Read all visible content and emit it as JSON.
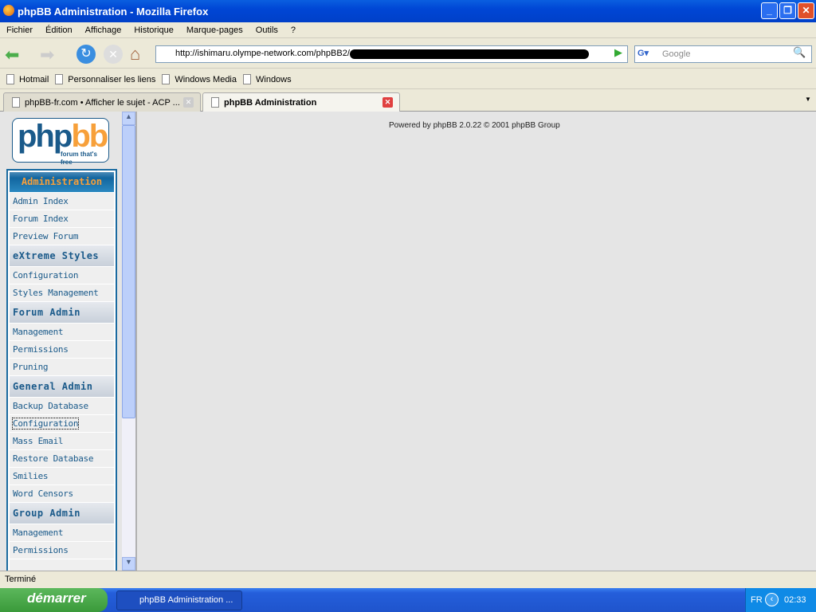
{
  "window": {
    "title": "phpBB Administration - Mozilla Firefox"
  },
  "menu": [
    "Fichier",
    "Édition",
    "Affichage",
    "Historique",
    "Marque-pages",
    "Outils",
    "?"
  ],
  "toolbar": {
    "url": "http://ishimaru.olympe-network.com/phpBB2/",
    "search_placeholder": "Google"
  },
  "bookmarks": [
    "Hotmail",
    "Personnaliser les liens",
    "Windows Media",
    "Windows"
  ],
  "tabs": [
    {
      "label": "phpBB-fr.com • Afficher le sujet - ACP ..."
    },
    {
      "label": "phpBB Administration"
    }
  ],
  "logo": {
    "text1": "php",
    "text2": "bb",
    "tagline": "forum that's free"
  },
  "nav": {
    "admin_header": "Administration",
    "admin": [
      "Admin Index",
      "Forum Index",
      "Preview Forum"
    ],
    "sections": [
      {
        "title": "eXtreme Styles",
        "items": [
          "Configuration",
          "Styles Management"
        ]
      },
      {
        "title": "Forum Admin",
        "items": [
          "Management",
          "Permissions",
          "Pruning"
        ]
      },
      {
        "title": "General Admin",
        "items": [
          "Backup Database",
          "Configuration",
          "Mass Email",
          "Restore Database",
          "Smilies",
          "Word Censors"
        ]
      },
      {
        "title": "Group Admin",
        "items": [
          "Management",
          "Permissions"
        ]
      }
    ]
  },
  "main": {
    "powered": "Powered by phpBB 2.0.22 © 2001 phpBB Group"
  },
  "status": "Terminé",
  "taskbar": {
    "start": "démarrer",
    "task": "phpBB Administration ...",
    "lang": "FR",
    "clock": "02:33"
  }
}
